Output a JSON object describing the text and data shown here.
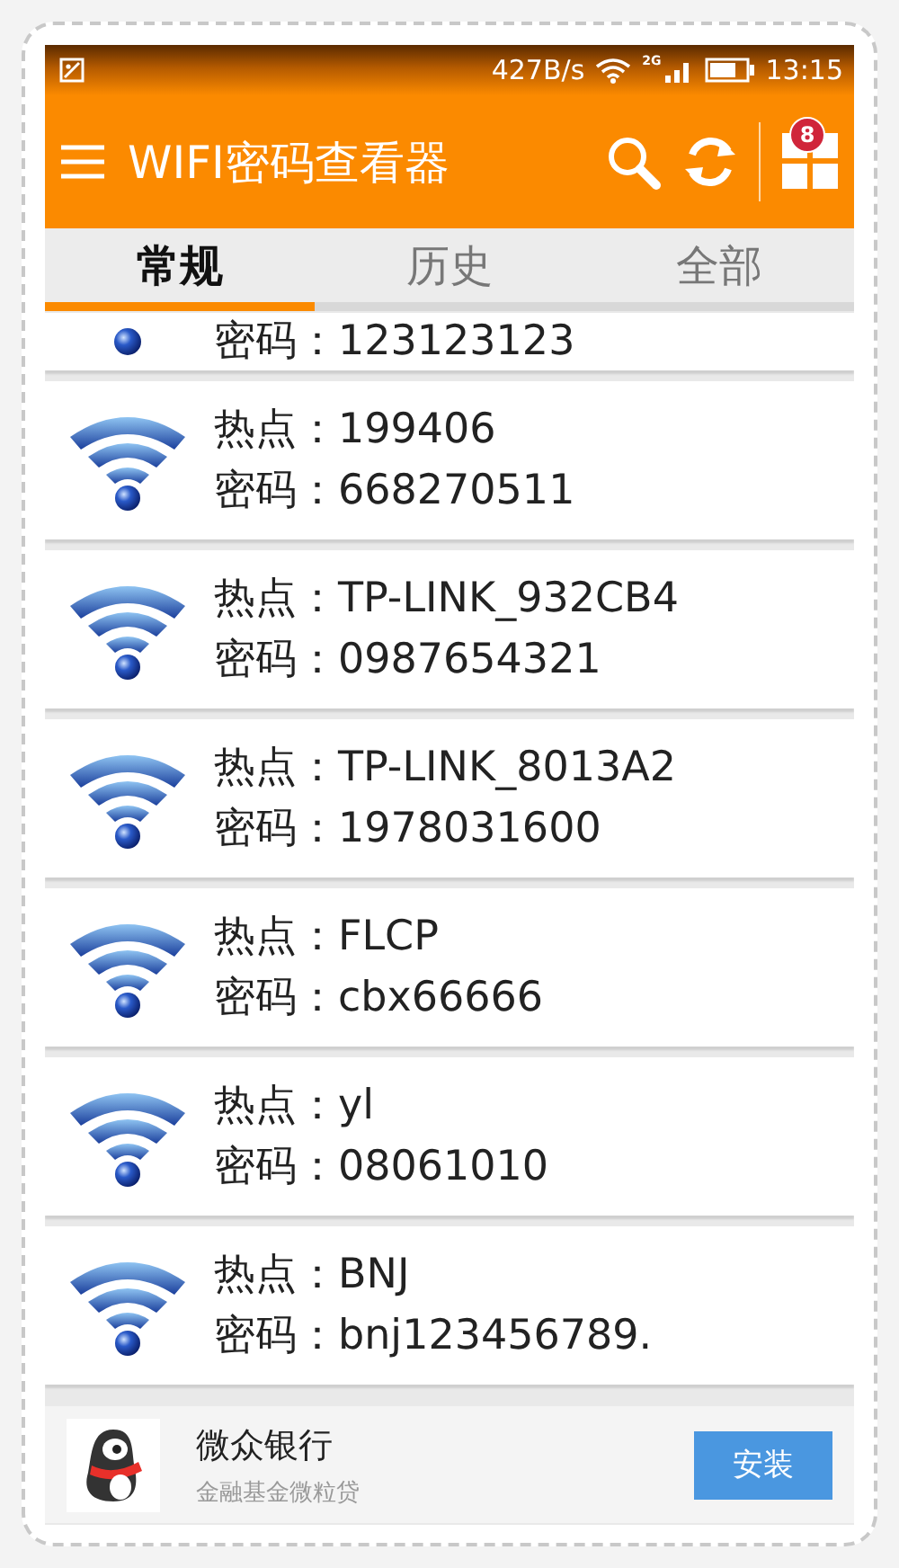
{
  "status_bar": {
    "speed": "427B/s",
    "network": "2G",
    "time": "13:15"
  },
  "app_bar": {
    "title": "WIFI密码查看器",
    "badge": "8"
  },
  "tabs": [
    {
      "label": "常规",
      "selected": true
    },
    {
      "label": "历史",
      "selected": false
    },
    {
      "label": "全部",
      "selected": false
    }
  ],
  "networks": [
    {
      "kind": "partial",
      "lines": [
        {
          "label": "密码：",
          "value": "123123123"
        }
      ]
    },
    {
      "kind": "full",
      "lines": [
        {
          "label": "热点：",
          "value": "199406"
        },
        {
          "label": "密码：",
          "value": "668270511"
        }
      ]
    },
    {
      "kind": "full",
      "lines": [
        {
          "label": "热点：",
          "value": "TP-LINK_932CB4"
        },
        {
          "label": "密码：",
          "value": "0987654321"
        }
      ]
    },
    {
      "kind": "full",
      "lines": [
        {
          "label": "热点：",
          "value": "TP-LINK_8013A2"
        },
        {
          "label": "密码：",
          "value": "1978031600"
        }
      ]
    },
    {
      "kind": "full",
      "lines": [
        {
          "label": "热点：",
          "value": "FLCP"
        },
        {
          "label": "密码：",
          "value": "cbx66666"
        }
      ]
    },
    {
      "kind": "full",
      "lines": [
        {
          "label": "热点：",
          "value": "yl"
        },
        {
          "label": "密码：",
          "value": "08061010"
        }
      ]
    },
    {
      "kind": "full",
      "lines": [
        {
          "label": "热点：",
          "value": "BNJ"
        },
        {
          "label": "密码：",
          "value": "bnj123456789."
        }
      ]
    }
  ],
  "ad": {
    "title": "微众银行",
    "subtitle": "金融基金微粒贷",
    "button": "安装"
  }
}
